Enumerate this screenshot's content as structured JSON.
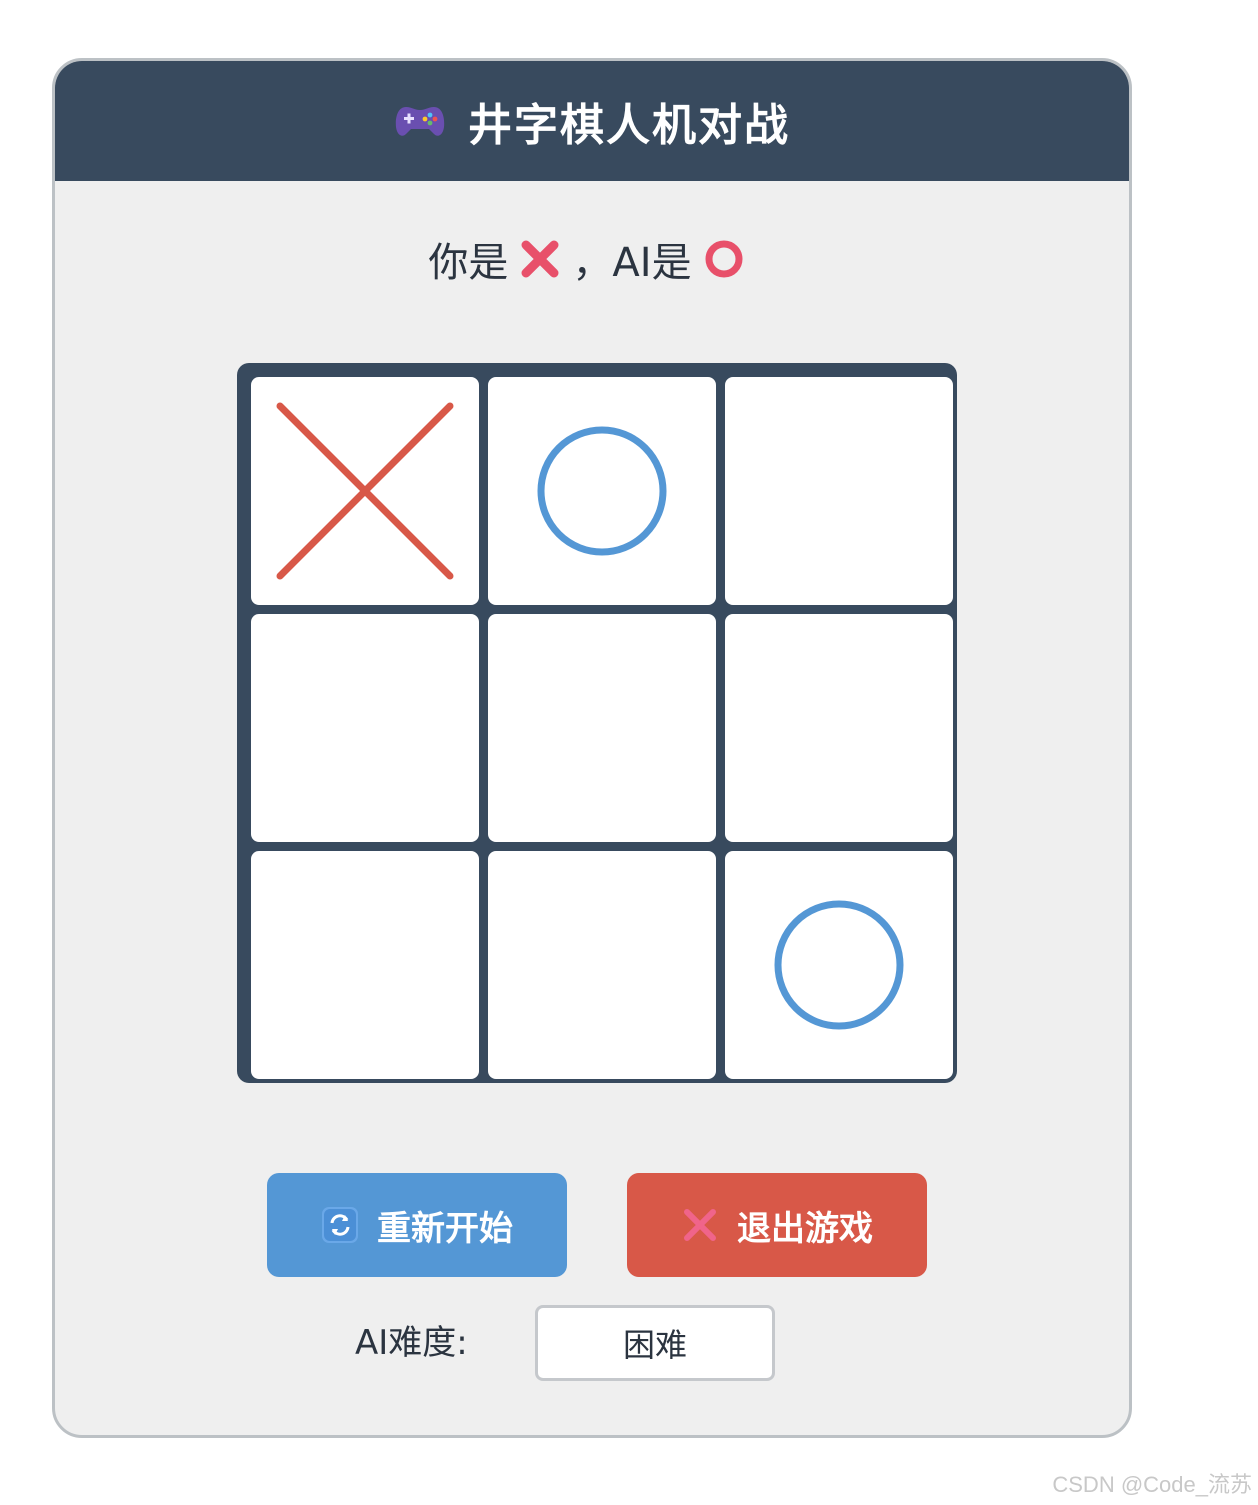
{
  "header": {
    "icon": "game-controller-icon",
    "title": "井字棋人机对战"
  },
  "info": {
    "you_are": "你是",
    "separator": "，",
    "ai_is": "AI是",
    "player_mark_icon": "cross-mark-icon",
    "ai_mark_icon": "circle-mark-icon"
  },
  "board": {
    "cells": [
      "X",
      "O",
      "",
      "",
      "",
      "",
      "",
      "",
      "O"
    ]
  },
  "colors": {
    "header_bg": "#384a5e",
    "x_color": "#d85848",
    "o_color": "#5497d5",
    "restart_bg": "#5497d5",
    "exit_bg": "#d85848"
  },
  "buttons": {
    "restart_label": "重新开始",
    "restart_icon": "refresh-icon",
    "exit_label": "退出游戏",
    "exit_icon": "cross-icon"
  },
  "difficulty": {
    "label": "AI难度:",
    "value": "困难"
  },
  "watermark": "CSDN @Code_流苏"
}
